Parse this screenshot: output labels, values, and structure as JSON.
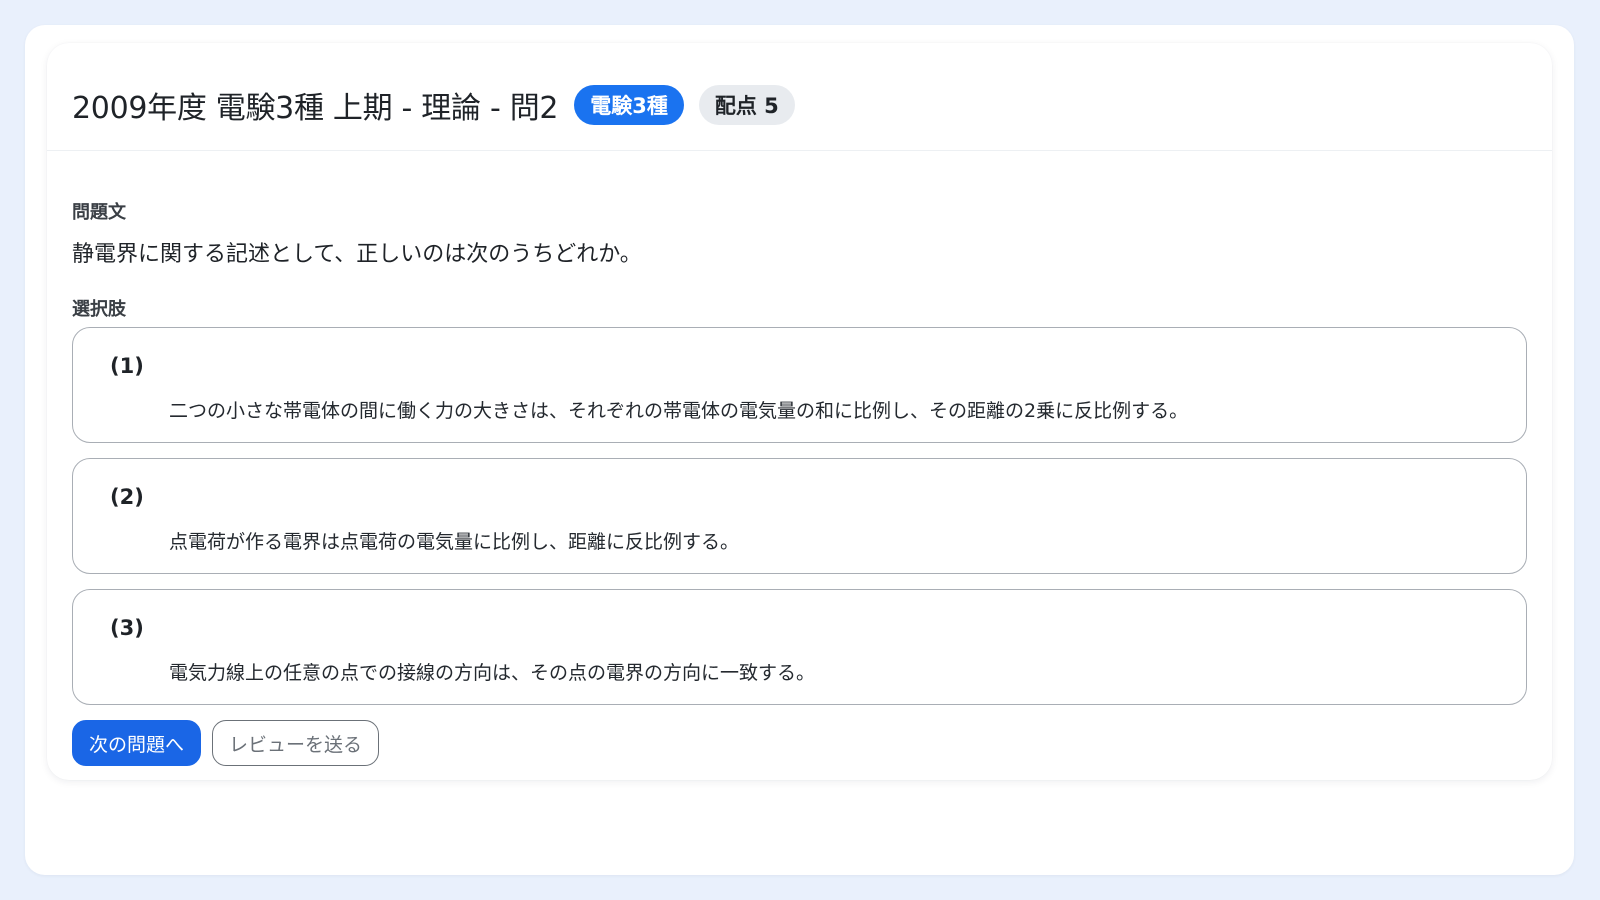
{
  "header": {
    "title": "2009年度 電験3種 上期 - 理論 - 問2",
    "category_badge": "電験3種",
    "points_badge": "配点 5"
  },
  "question": {
    "label": "問題文",
    "text": "静電界に関する記述として、正しいのは次のうちどれか。"
  },
  "choices": {
    "label": "選択肢",
    "items": [
      {
        "number": "(1)",
        "text": "二つの小さな帯電体の間に働く力の大きさは、それぞれの帯電体の電気量の和に比例し、その距離の2乗に反比例する。"
      },
      {
        "number": "(2)",
        "text": "点電荷が作る電界は点電荷の電気量に比例し、距離に反比例する。"
      },
      {
        "number": "(3)",
        "text": "電気力線上の任意の点での接線の方向は、その点の電界の方向に一致する。"
      }
    ]
  },
  "actions": {
    "next_label": "次の問題へ",
    "review_label": "レビューを送る"
  },
  "colors": {
    "page_background": "#e9f0fc",
    "accent": "#1a73f0",
    "button_primary": "#1a66e6"
  }
}
